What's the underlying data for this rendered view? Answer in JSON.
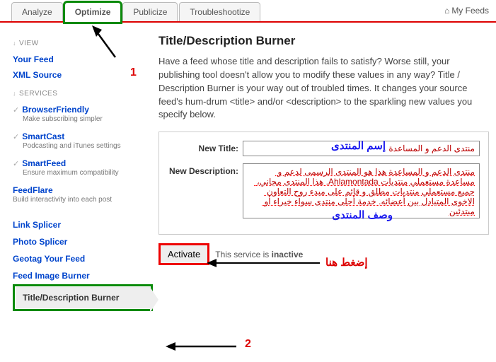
{
  "tabs": {
    "analyze": "Analyze",
    "optimize": "Optimize",
    "publicize": "Publicize",
    "troubleshootize": "Troubleshootize",
    "myfeeds": "My Feeds"
  },
  "sidebar": {
    "view_label": "VIEW",
    "your_feed": "Your Feed",
    "xml_source": "XML Source",
    "services_label": "SERVICES",
    "browserfriendly": {
      "name": "BrowserFriendly",
      "desc": "Make subscribing simpler"
    },
    "smartcast": {
      "name": "SmartCast",
      "desc": "Podcasting and iTunes settings"
    },
    "smartfeed": {
      "name": "SmartFeed",
      "desc": "Ensure maximum compatibility"
    },
    "feedflare": {
      "name": "FeedFlare",
      "desc": "Build interactivity into each post"
    },
    "link_splicer": "Link Splicer",
    "photo_splicer": "Photo Splicer",
    "geotag": "Geotag Your Feed",
    "feed_image_burner": "Feed Image Burner",
    "title_desc_burner": "Title/Description Burner"
  },
  "page": {
    "title": "Title/Description Burner",
    "description": "Have a feed whose title and description fails to satisfy? Worse still, your publishing tool doesn't allow you to modify these values in any way? Title / Description Burner is your way out of troubled times. It changes your source feed's hum-drum <title> and/or <description> to the sparkling new values you specify below."
  },
  "form": {
    "new_title_label": "New Title:",
    "new_title_value": "منتدى الدعم و المساعدة",
    "new_desc_label": "New Description:",
    "new_desc_value": "منتدى الدعم و المساعدة هذا هو المنتدى الرسمى لدعم و مساعدة مستعملي منتديات Ahlamontada. هذا المنتدى مجاني، جميع مستعملي منتديات مطلق و قائم على مبدء روح التعاون الاخوى المتبادل بين أعضائه. خدمة أحلى منتدى سواء خبراء أو مبتدئين"
  },
  "activate": {
    "button": "Activate",
    "status_prefix": "This service is ",
    "status_value": "inactive"
  },
  "annotations": {
    "num1": "1",
    "num2": "2",
    "name_label": "إسم المنتدى",
    "desc_label": "وصف المنتدى",
    "click_here": "إضغط هنا"
  }
}
